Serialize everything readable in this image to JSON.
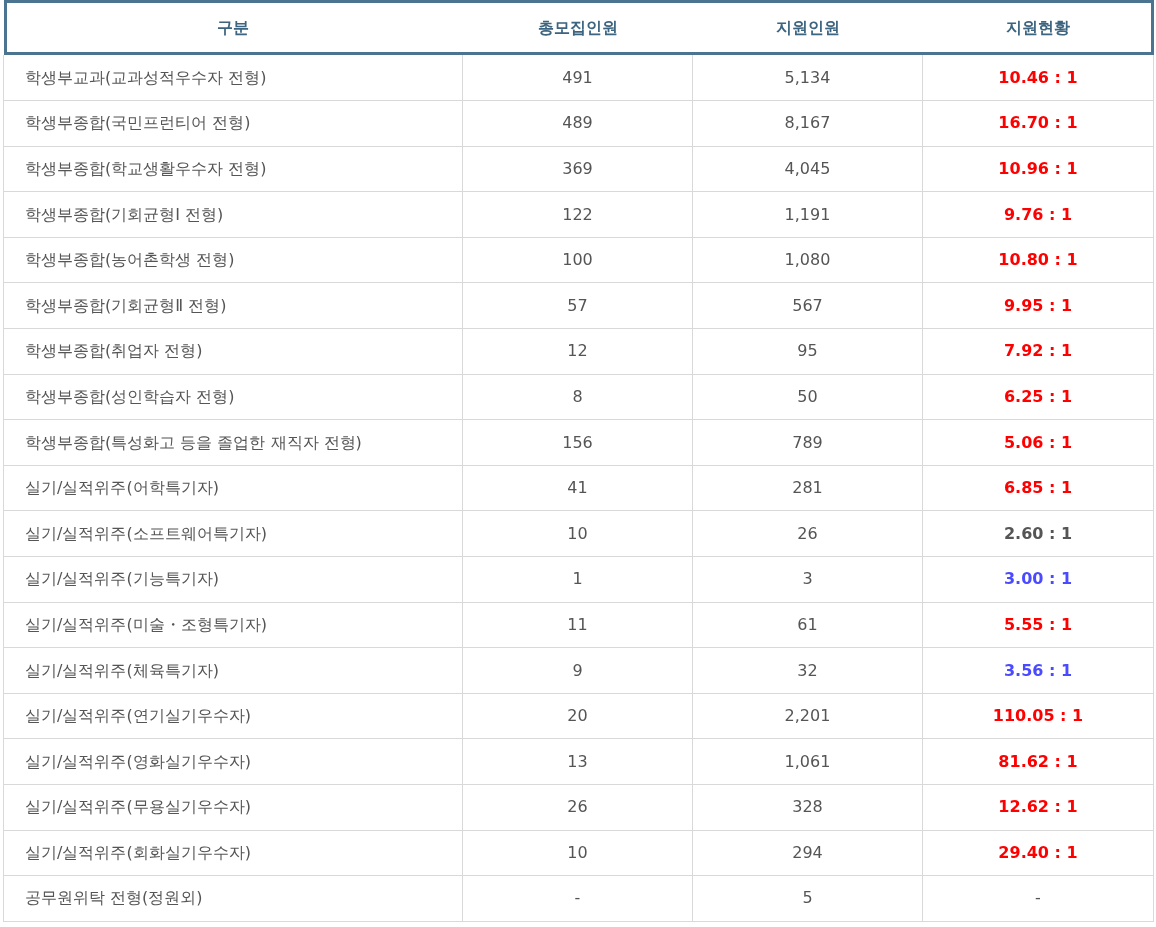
{
  "table": {
    "columns": [
      "구분",
      "총모집인원",
      "지원인원",
      "지원현황"
    ],
    "rows": [
      {
        "category": "학생부교과(교과성적우수자 전형)",
        "quota": "491",
        "applicants": "5,134",
        "ratio": "10.46 : 1",
        "kind": "ratio",
        "color": "#ff0000"
      },
      {
        "category": "학생부종합(국민프런티어 전형)",
        "quota": "489",
        "applicants": "8,167",
        "ratio": "16.70 : 1",
        "kind": "ratio",
        "color": "#ff0000"
      },
      {
        "category": "학생부종합(학교생활우수자 전형)",
        "quota": "369",
        "applicants": "4,045",
        "ratio": "10.96 : 1",
        "kind": "ratio",
        "color": "#ff0000"
      },
      {
        "category": "학생부종합(기회균형Ⅰ 전형)",
        "quota": "122",
        "applicants": "1,191",
        "ratio": "9.76 : 1",
        "kind": "ratio",
        "color": "#ff0000"
      },
      {
        "category": "학생부종합(농어촌학생 전형)",
        "quota": "100",
        "applicants": "1,080",
        "ratio": "10.80 : 1",
        "kind": "ratio",
        "color": "#ff0000"
      },
      {
        "category": "학생부종합(기회균형Ⅱ 전형)",
        "quota": "57",
        "applicants": "567",
        "ratio": "9.95 : 1",
        "kind": "ratio",
        "color": "#ff0000"
      },
      {
        "category": "학생부종합(취업자 전형)",
        "quota": "12",
        "applicants": "95",
        "ratio": "7.92 : 1",
        "kind": "ratio",
        "color": "#ff0000"
      },
      {
        "category": "학생부종합(성인학습자 전형)",
        "quota": "8",
        "applicants": "50",
        "ratio": "6.25 : 1",
        "kind": "ratio",
        "color": "#ff0000"
      },
      {
        "category": "학생부종합(특성화고 등을 졸업한 재직자 전형)",
        "quota": "156",
        "applicants": "789",
        "ratio": "5.06 : 1",
        "kind": "ratio",
        "color": "#ff0000"
      },
      {
        "category": "실기/실적위주(어학특기자)",
        "quota": "41",
        "applicants": "281",
        "ratio": "6.85 : 1",
        "kind": "ratio",
        "color": "#ff0000"
      },
      {
        "category": "실기/실적위주(소프트웨어특기자)",
        "quota": "10",
        "applicants": "26",
        "ratio": "2.60 : 1",
        "kind": "ratio",
        "color": "#555555"
      },
      {
        "category": "실기/실적위주(기능특기자)",
        "quota": "1",
        "applicants": "3",
        "ratio": "3.00 : 1",
        "kind": "ratio",
        "color": "#4a4aff"
      },
      {
        "category": "실기/실적위주(미술・조형특기자)",
        "quota": "11",
        "applicants": "61",
        "ratio": "5.55 : 1",
        "kind": "ratio",
        "color": "#ff0000"
      },
      {
        "category": "실기/실적위주(체육특기자)",
        "quota": "9",
        "applicants": "32",
        "ratio": "3.56 : 1",
        "kind": "ratio",
        "color": "#4a4aff"
      },
      {
        "category": "실기/실적위주(연기실기우수자)",
        "quota": "20",
        "applicants": "2,201",
        "ratio": "110.05 : 1",
        "kind": "ratio",
        "color": "#ff0000"
      },
      {
        "category": "실기/실적위주(영화실기우수자)",
        "quota": "13",
        "applicants": "1,061",
        "ratio": "81.62 : 1",
        "kind": "ratio",
        "color": "#ff0000"
      },
      {
        "category": "실기/실적위주(무용실기우수자)",
        "quota": "26",
        "applicants": "328",
        "ratio": "12.62 : 1",
        "kind": "ratio",
        "color": "#ff0000"
      },
      {
        "category": "실기/실적위주(회화실기우수자)",
        "quota": "10",
        "applicants": "294",
        "ratio": "29.40 : 1",
        "kind": "ratio",
        "color": "#ff0000"
      },
      {
        "category": "공무원위탁 전형(정원외)",
        "quota": "-",
        "applicants": "5",
        "ratio": "-",
        "kind": "none"
      }
    ]
  }
}
